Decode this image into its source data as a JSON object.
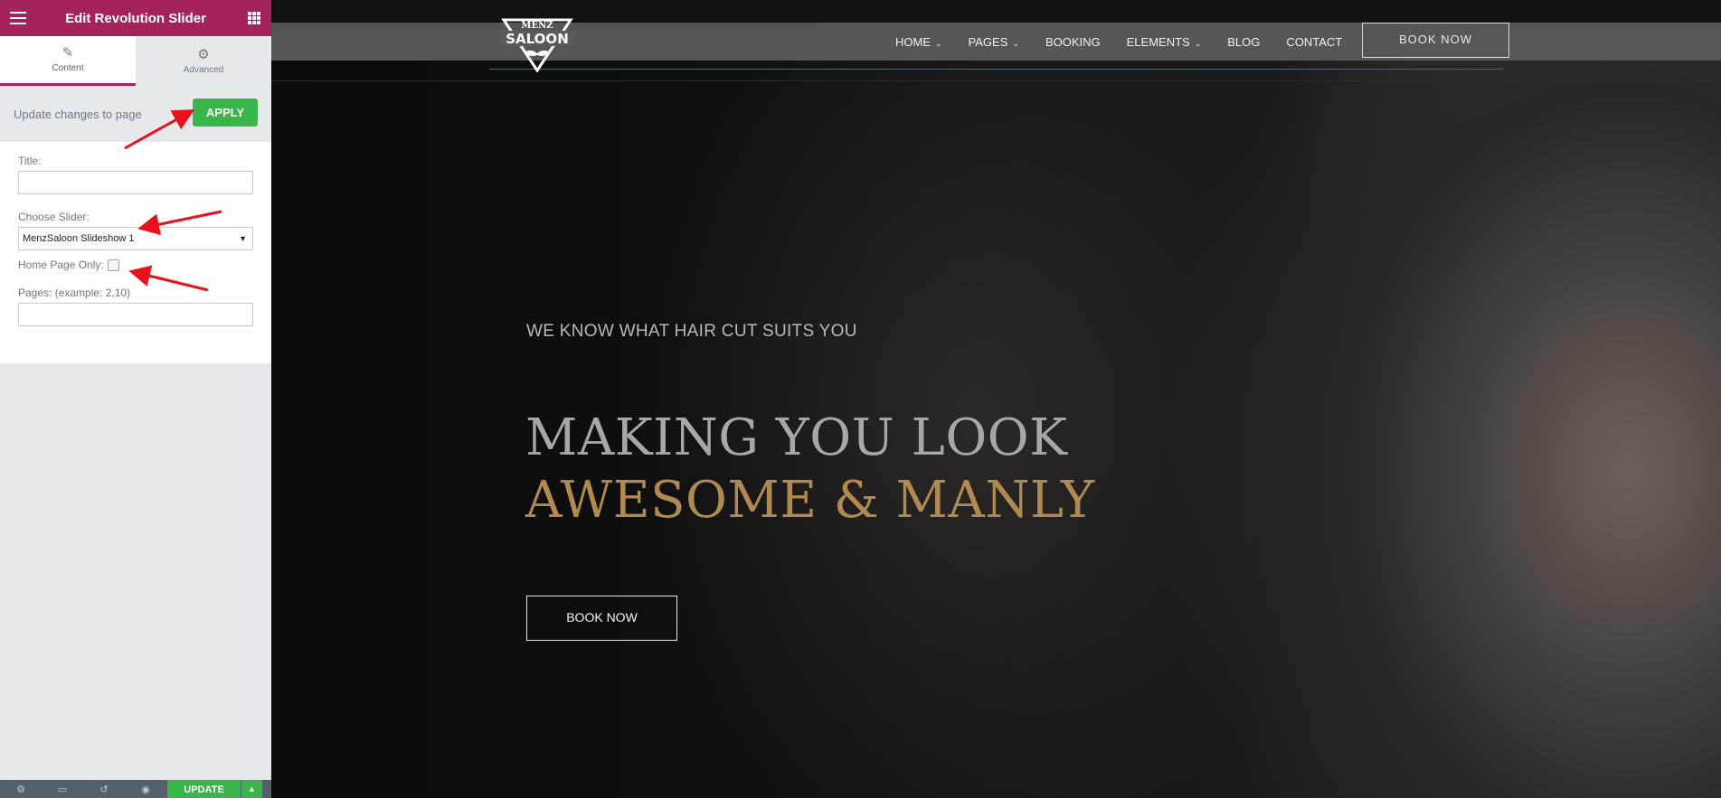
{
  "panel": {
    "title": "Edit Revolution Slider",
    "tabs": [
      {
        "label": "Content",
        "icon": "pencil-icon"
      },
      {
        "label": "Advanced",
        "icon": "gear-icon"
      }
    ],
    "update_text": "Update changes to page",
    "apply_label": "APPLY",
    "fields": {
      "title_label": "Title:",
      "title_value": "",
      "slider_label": "Choose Slider:",
      "slider_value": "MenzSaloon Slideshow 1",
      "home_only_label": "Home Page Only:",
      "home_only_checked": false,
      "pages_label": "Pages: (example: 2,10)",
      "pages_value": ""
    },
    "footer": {
      "icons": [
        "settings-icon",
        "responsive-icon",
        "history-icon",
        "preview-eye-icon"
      ],
      "update_label": "UPDATE"
    },
    "colors": {
      "header": "#a4235a",
      "apply": "#39b54a"
    }
  },
  "site": {
    "logo_text_top": "MENZ",
    "logo_text": "SALOON",
    "menu": [
      {
        "label": "HOME",
        "dropdown": true
      },
      {
        "label": "PAGES",
        "dropdown": true
      },
      {
        "label": "BOOKING",
        "dropdown": false
      },
      {
        "label": "ELEMENTS",
        "dropdown": true
      },
      {
        "label": "BLOG",
        "dropdown": false
      },
      {
        "label": "CONTACT",
        "dropdown": false
      }
    ],
    "book_now_nav": "BOOK NOW",
    "hero": {
      "tagline": "WE KNOW WHAT HAIR CUT SUITS YOU",
      "headline_line1": "MAKING YOU LOOK",
      "headline_line2": "AWESOME & MANLY",
      "button": "BOOK NOW"
    },
    "colors": {
      "accent": "#b18a52"
    }
  }
}
